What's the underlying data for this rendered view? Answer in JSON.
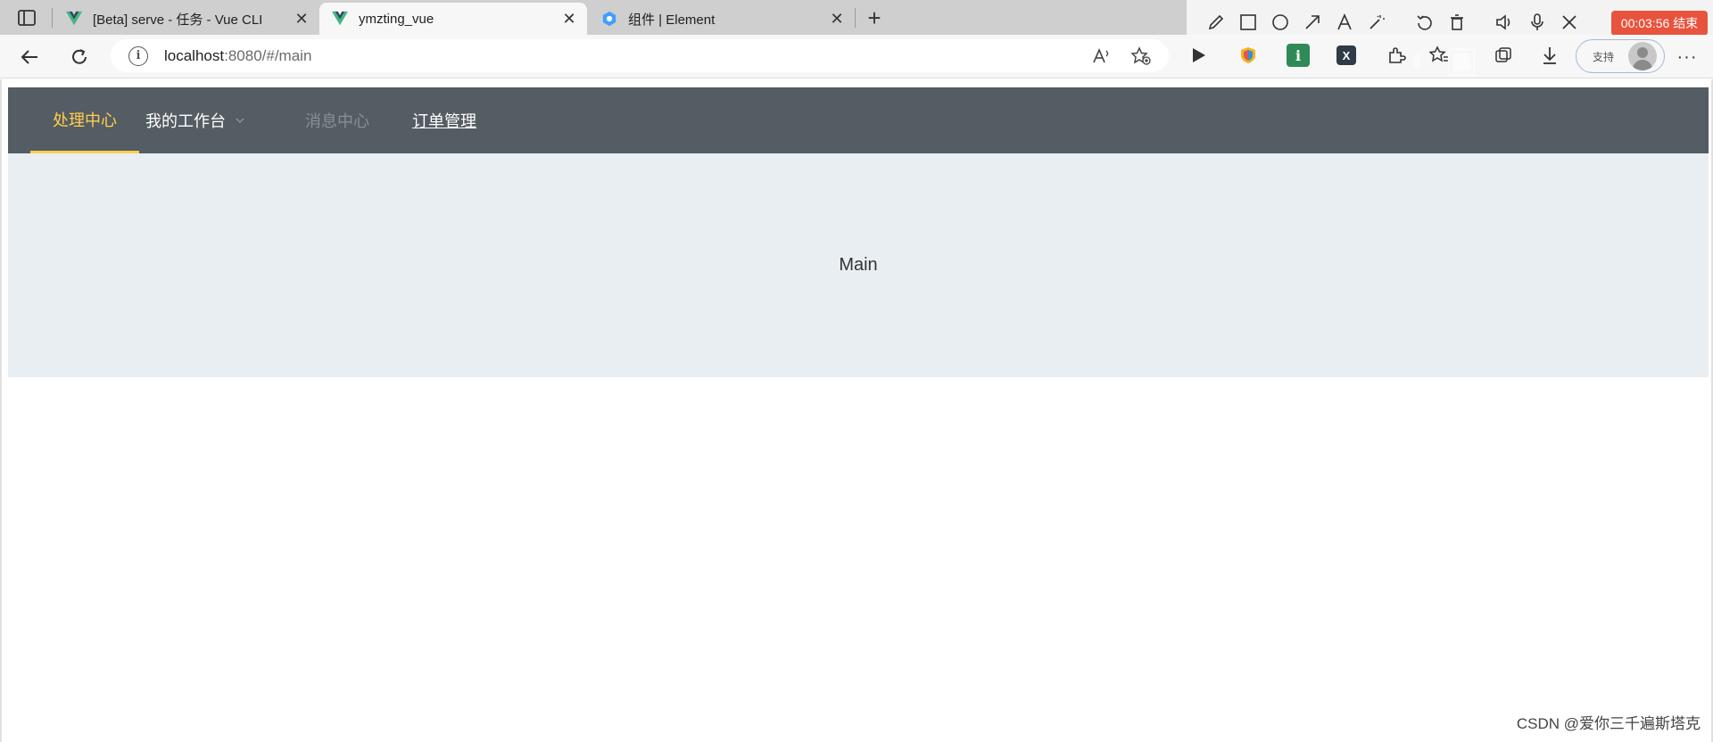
{
  "browser": {
    "tabs": [
      {
        "title": "[Beta] serve - 任务 - Vue CLI",
        "favicon": "vue-icon",
        "active": false
      },
      {
        "title": "ymzting_vue",
        "favicon": "vue-icon",
        "active": true
      },
      {
        "title": "组件 | Element",
        "favicon": "element-icon",
        "active": false
      }
    ],
    "address": {
      "host": "localhost",
      "rest": ":8080/#/main"
    },
    "recording": {
      "timer": "00:03:56",
      "stop_label": "结束"
    },
    "profile_label": "支持",
    "colors": {
      "tabbar": "#cfcfcf",
      "toolbar": "#f7f7f7",
      "recording": "#e8533e"
    }
  },
  "app": {
    "menu": [
      {
        "label": "处理中心",
        "state": "active"
      },
      {
        "label": "我的工作台",
        "state": "submenu"
      },
      {
        "label": "消息中心",
        "state": "disabled"
      },
      {
        "label": "订单管理",
        "state": "link"
      }
    ],
    "main_text": "Main",
    "colors": {
      "header_bg": "#545c64",
      "active_text": "#ffd04b",
      "main_bg": "#e9eef3"
    }
  },
  "watermark": "CSDN @爱你三千遍斯塔克"
}
